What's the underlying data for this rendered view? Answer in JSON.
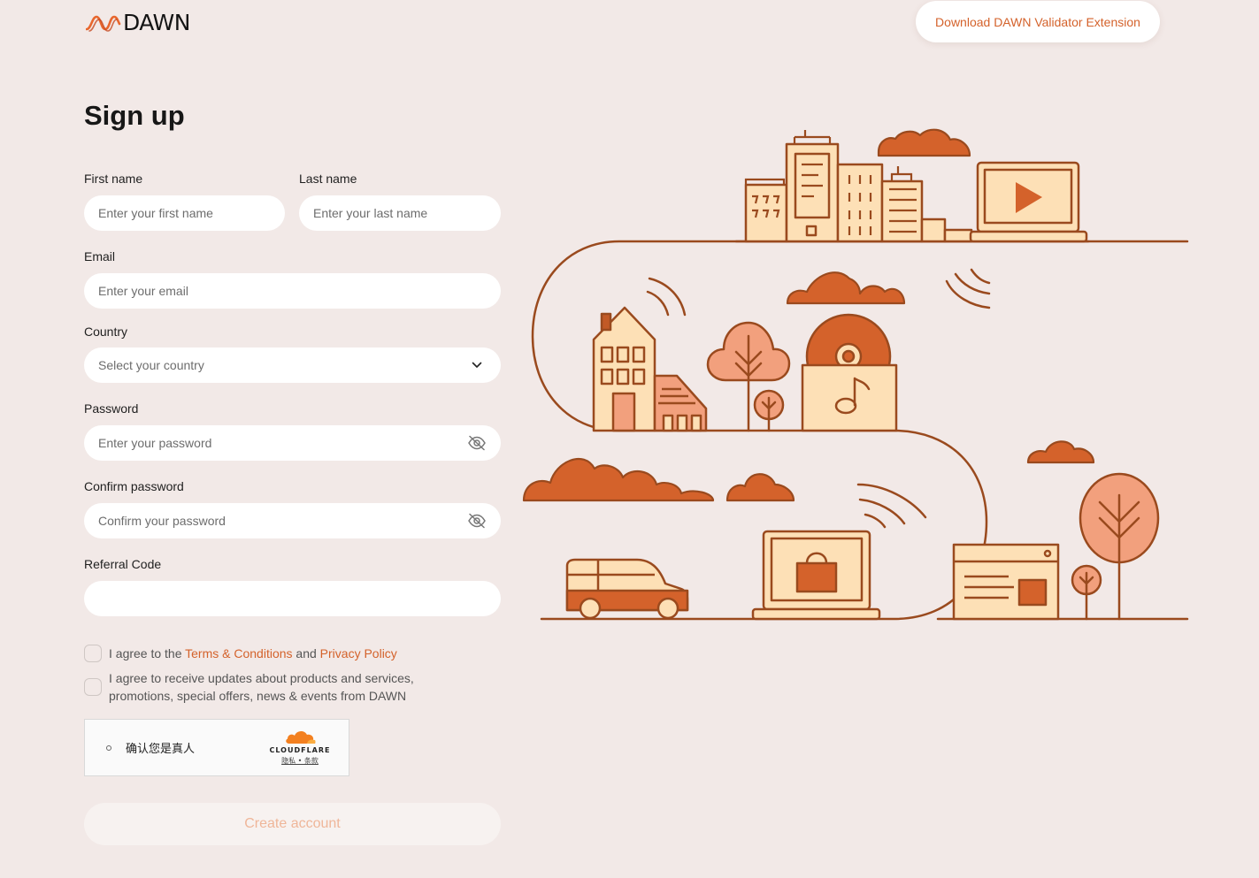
{
  "brand": {
    "name": "DAWN"
  },
  "header": {
    "extension_button": "Download DAWN Validator Extension"
  },
  "form": {
    "title": "Sign up",
    "first_name": {
      "label": "First name",
      "placeholder": "Enter your first name"
    },
    "last_name": {
      "label": "Last name",
      "placeholder": "Enter your last name"
    },
    "email": {
      "label": "Email",
      "placeholder": "Enter your email"
    },
    "country": {
      "label": "Country",
      "placeholder": "Select your country"
    },
    "password": {
      "label": "Password",
      "placeholder": "Enter your password"
    },
    "confirm_password": {
      "label": "Confirm password",
      "placeholder": "Confirm your password"
    },
    "referral": {
      "label": "Referral Code",
      "value": ""
    },
    "terms": {
      "prefix": "I agree to the ",
      "terms_link": "Terms & Conditions",
      "middle": " and ",
      "privacy_link": "Privacy Policy"
    },
    "updates": {
      "line1": "I agree to receive updates about products and services,",
      "line2": "promotions, special offers, news & events from DAWN"
    },
    "captcha": {
      "label": "确认您是真人",
      "provider": "CLOUDFLARE",
      "links": "隐私 • 条款"
    },
    "submit": "Create account"
  },
  "colors": {
    "accent": "#d4622b",
    "background": "#f2e9e7",
    "illustration_fill": "#fde0b6",
    "illustration_stroke": "#9a4a1e",
    "illustration_dark": "#d4622b",
    "illustration_mid": "#f2a07d"
  }
}
